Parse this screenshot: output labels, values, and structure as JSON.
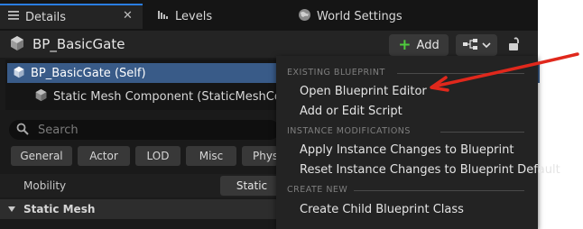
{
  "tabs": [
    {
      "label": "Details",
      "icon": "details-icon",
      "active": true
    },
    {
      "label": "Levels",
      "icon": "levels-icon",
      "active": false
    },
    {
      "label": "World Settings",
      "icon": "globe-icon",
      "active": false
    }
  ],
  "close_glyph": "✕",
  "header": {
    "title": "BP_BasicGate",
    "add_label": "Add",
    "add_glyph": "+"
  },
  "tree": {
    "self_label": "BP_BasicGate (Self)",
    "mesh_label": "Static Mesh Component (StaticMeshCompo"
  },
  "search": {
    "placeholder": "Search"
  },
  "categories": [
    "General",
    "Actor",
    "LOD",
    "Misc",
    "Phys"
  ],
  "mobility": {
    "label": "Mobility",
    "value": "Static"
  },
  "section": {
    "label": "Static Mesh"
  },
  "menu": {
    "section_existing": "EXISTING BLUEPRINT",
    "open_editor": "Open Blueprint Editor",
    "add_edit_script": "Add or Edit Script",
    "section_instance": "INSTANCE MODIFICATIONS",
    "apply_changes": "Apply Instance Changes to Blueprint",
    "reset_changes": "Reset Instance Changes to Blueprint Default",
    "section_create": "CREATE NEW",
    "create_child": "Create Child Blueprint Class"
  },
  "colors": {
    "accent_blue": "#2a7de1",
    "selection": "#395b88",
    "add_green": "#4ecb3d",
    "annotation_red": "#e0281c"
  }
}
